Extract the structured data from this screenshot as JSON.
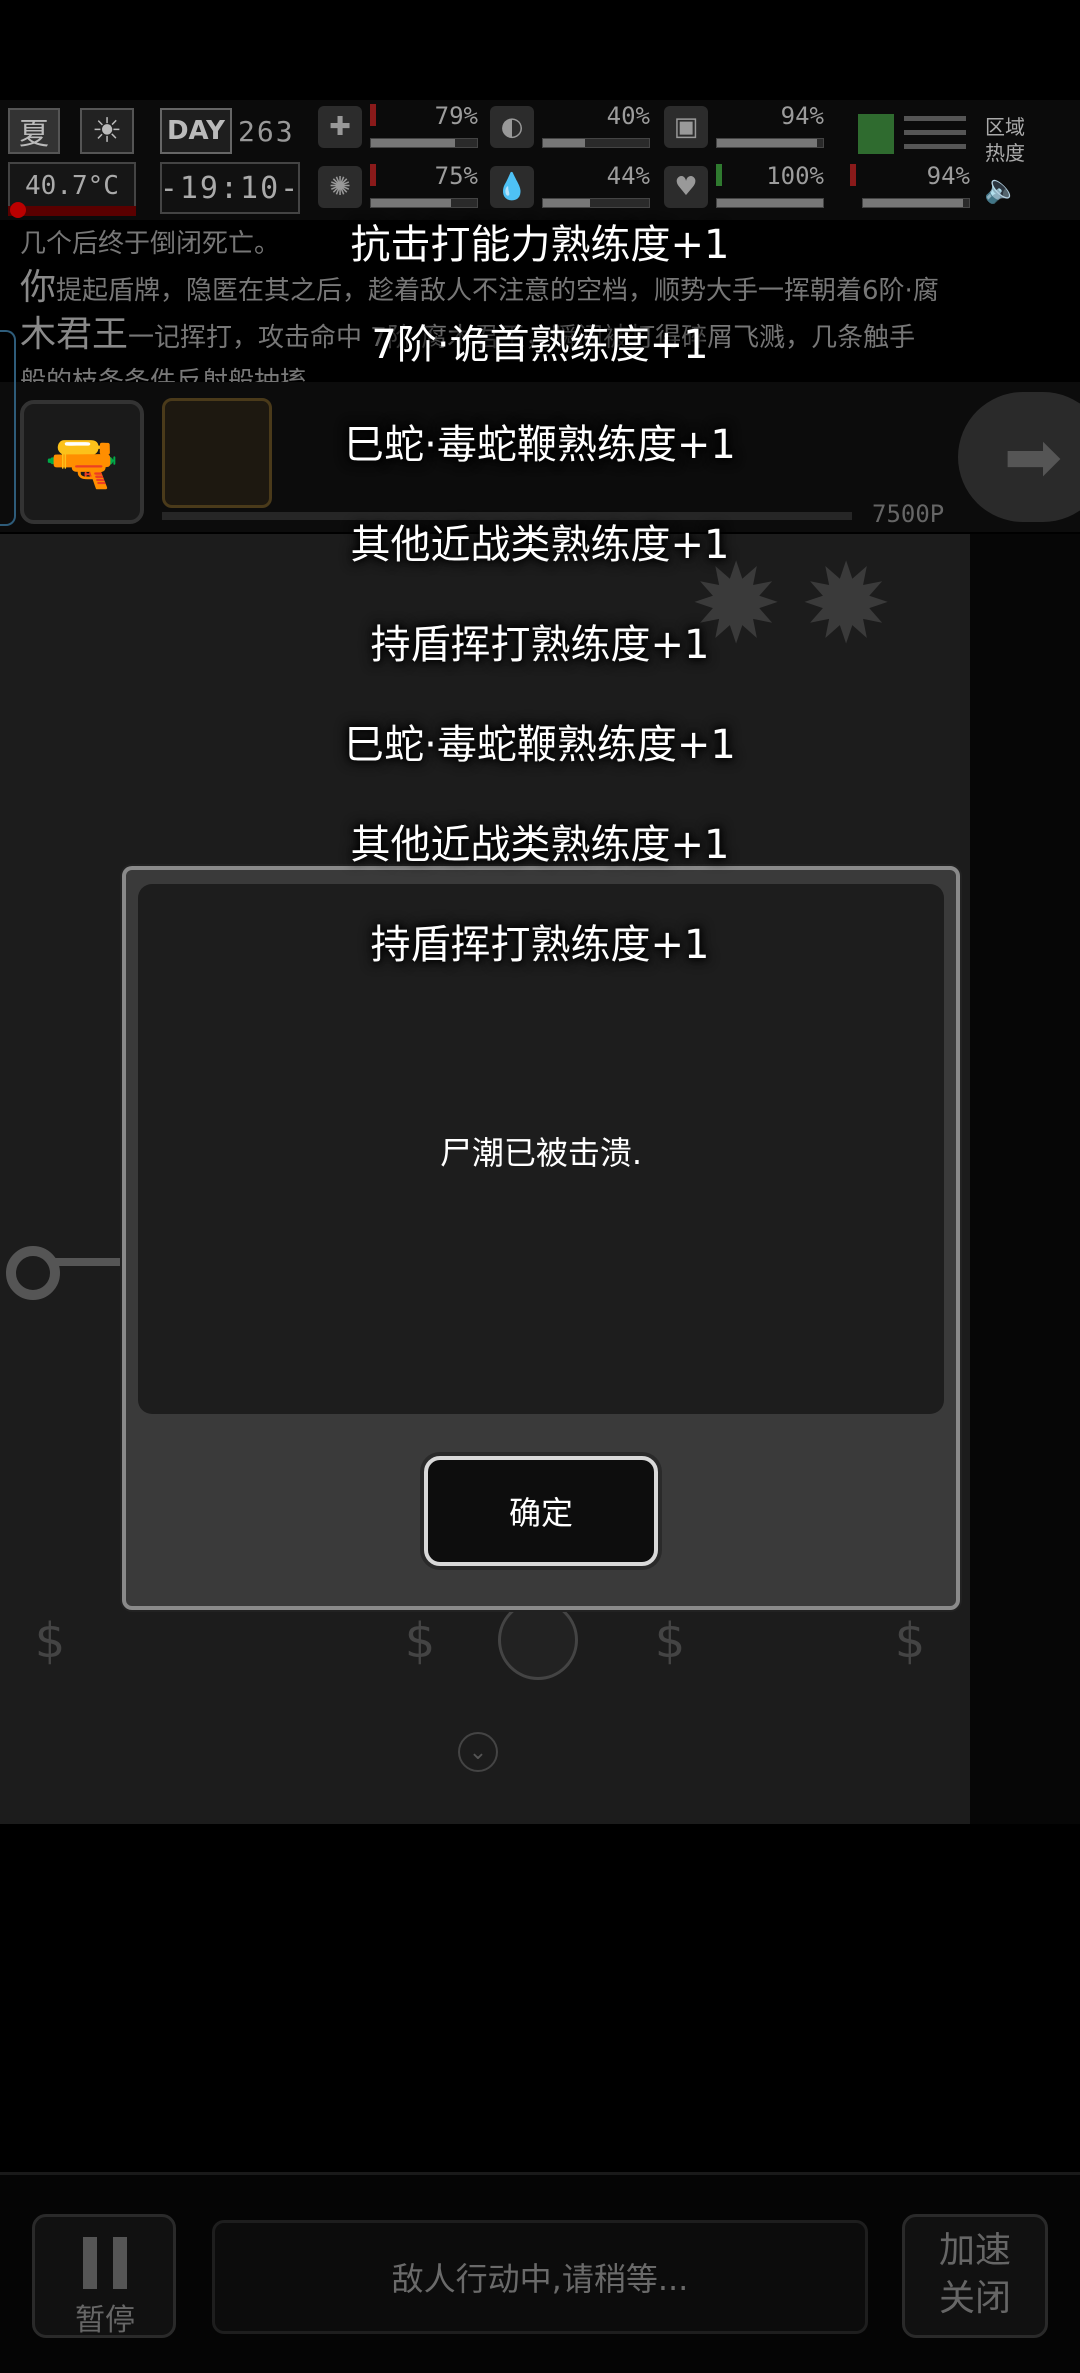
{
  "hud": {
    "season": "夏",
    "temperature": "40.7°C",
    "day_label": "DAY",
    "day_number": "263",
    "clock": "-19:10-",
    "stats": [
      {
        "icon": "medkit-icon",
        "value": "79%",
        "level": 0.79
      },
      {
        "icon": "stomach-icon",
        "value": "40%",
        "level": 0.4
      },
      {
        "icon": "backpack-icon",
        "value": "94%",
        "level": 0.94
      },
      {
        "icon": "brain-icon",
        "value": "75%",
        "level": 0.75
      },
      {
        "icon": "water-drop-icon",
        "value": "44%",
        "level": 0.44
      },
      {
        "icon": "heart-icon",
        "value": "100%",
        "level": 1.0
      },
      {
        "icon": "stamina-icon",
        "value": "94%",
        "level": 0.94
      }
    ],
    "region_label": "区域热度",
    "speaker_icon": "🔈"
  },
  "log": {
    "line1": "几个后终于倒闭死亡。",
    "line2_em": "你",
    "line2": "提起盾牌，隐匿在其之后，趁着敌人不注意的空档，顺势大手一挥朝着6阶·腐",
    "line3_em": "木君王",
    "line3": "一记挥打，攻击命中  7阶·腐木君王，瞬间被打得碎屑飞溅，几条触手",
    "line4": "般的枝条条件反射般抽搐。"
  },
  "action": {
    "hp_text": "7500P"
  },
  "gains": [
    "抗击打能力熟练度+1",
    "7阶·诡首熟练度+1",
    "巳蛇·毒蛇鞭熟练度+1",
    "其他近战类熟练度+1",
    "持盾挥打熟练度+1",
    "巳蛇·毒蛇鞭熟练度+1",
    "其他近战类熟练度+1",
    "持盾挥打熟练度+1"
  ],
  "modal": {
    "message": "尸潮已被击溃.",
    "confirm_label": "确定"
  },
  "bottom": {
    "pause_label": "暂停",
    "waiting_text": "敌人行动中,请稍等...",
    "speed_line1": "加速",
    "speed_line2": "关闭"
  }
}
